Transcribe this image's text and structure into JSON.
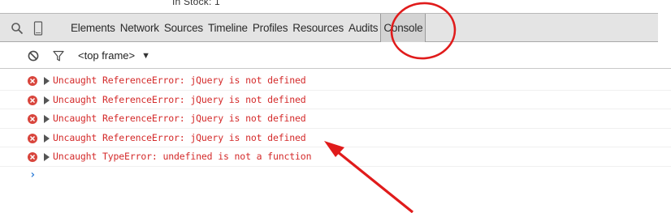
{
  "page_peek_text": "In Stock: 1",
  "devtools": {
    "tabs": [
      {
        "label": "Elements"
      },
      {
        "label": "Network"
      },
      {
        "label": "Sources"
      },
      {
        "label": "Timeline"
      },
      {
        "label": "Profiles"
      },
      {
        "label": "Resources"
      },
      {
        "label": "Audits"
      },
      {
        "label": "Console",
        "active": true
      }
    ],
    "icons": {
      "search": "search-icon",
      "device": "device-mode-icon"
    }
  },
  "console": {
    "toolbar": {
      "clear_icon": "clear-console-icon",
      "filter_icon": "filter-icon",
      "frame_select": "<top frame>"
    },
    "messages": [
      {
        "level": "error",
        "text": "Uncaught ReferenceError: jQuery is not defined"
      },
      {
        "level": "error",
        "text": "Uncaught ReferenceError: jQuery is not defined"
      },
      {
        "level": "error",
        "text": "Uncaught ReferenceError: jQuery is not defined"
      },
      {
        "level": "error",
        "text": "Uncaught ReferenceError: jQuery is not defined"
      },
      {
        "level": "error",
        "text": "Uncaught TypeError: undefined is not a function"
      }
    ],
    "prompt_symbol": "›"
  },
  "colors": {
    "error_text": "#d42a2a",
    "error_icon": "#d8453c",
    "annotation": "#e01b1b",
    "prompt": "#2f7ed8"
  }
}
